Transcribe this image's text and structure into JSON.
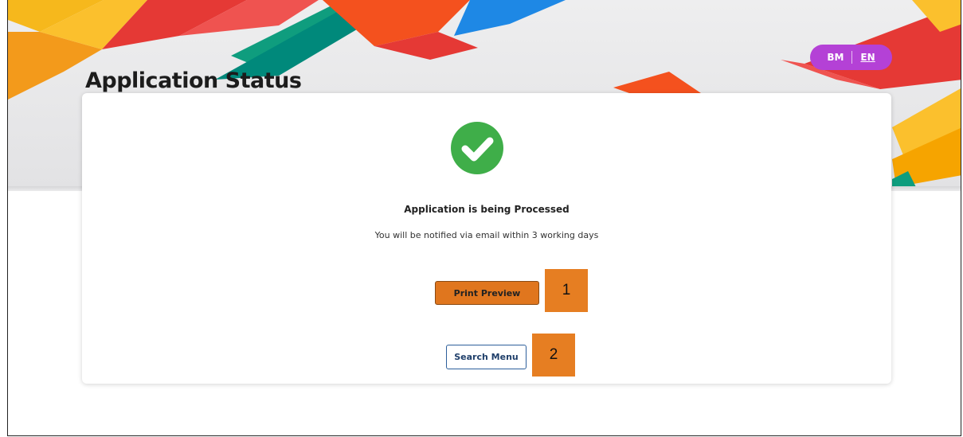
{
  "header": {
    "title": "Application Status",
    "language": {
      "options": [
        "BM",
        "EN"
      ],
      "selected": "EN"
    }
  },
  "status": {
    "icon": "check-circle-icon",
    "title": "Application is being Processed",
    "message": "You will be notified via email within 3 working days"
  },
  "actions": {
    "print_label": "Print Preview",
    "search_label": "Search Menu"
  },
  "callouts": [
    "1",
    "2"
  ],
  "colors": {
    "accent_purple": "#b441d6",
    "success_green": "#3fae49",
    "print_button": "#e0761e",
    "search_button_border": "#2d5f9b",
    "callout_orange": "#e67e22"
  }
}
